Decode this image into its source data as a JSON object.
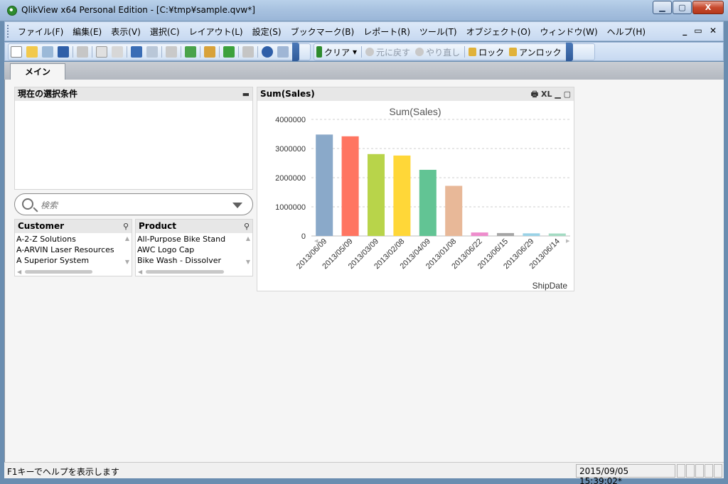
{
  "window": {
    "title": "QlikView x64 Personal Edition - [C:¥tmp¥sample.qvw*]",
    "minimize": "▁",
    "maximize": "▢",
    "close": "X"
  },
  "menu": {
    "items": [
      "ファイル(F)",
      "編集(E)",
      "表示(V)",
      "選択(C)",
      "レイアウト(L)",
      "設定(S)",
      "ブックマーク(B)",
      "レポート(R)",
      "ツール(T)",
      "オブジェクト(O)",
      "ウィンドウ(W)",
      "ヘルプ(H)"
    ],
    "right_controls": "_ ▭ ✕"
  },
  "toolbar": {
    "clear": "クリア",
    "undo": "元に戻す",
    "redo": "やり直し",
    "lock": "ロック",
    "unlock": "アンロック"
  },
  "tabs": [
    {
      "label": "メイン"
    }
  ],
  "current_selections": {
    "title": "現在の選択条件",
    "minimize": "▬"
  },
  "search": {
    "placeholder": "検索"
  },
  "customer_list": {
    "title": "Customer",
    "items": [
      "A-2-Z Solutions",
      "A-ARVIN Laser Resources",
      "A Superior System"
    ]
  },
  "product_list": {
    "title": "Product",
    "items": [
      "All-Purpose Bike Stand",
      "AWC Logo Cap",
      "Bike Wash - Dissolver"
    ]
  },
  "chart_object": {
    "caption": "Sum(Sales)",
    "icons": "🖶 XL ▁ ▢"
  },
  "chart_data": {
    "type": "bar",
    "title": "Sum(Sales)",
    "xlabel": "ShipDate",
    "ylabel": "",
    "categories": [
      "2013/06/09",
      "2013/05/09",
      "2013/03/09",
      "2013/02/08",
      "2013/04/09",
      "2013/01/08",
      "2013/06/22",
      "2013/06/15",
      "2013/06/29",
      "2013/06/14"
    ],
    "values": [
      3480000,
      3420000,
      2810000,
      2760000,
      2270000,
      1720000,
      120000,
      100000,
      90000,
      85000
    ],
    "colors": [
      "#8aa9c9",
      "#ff7561",
      "#b8d44a",
      "#ffd738",
      "#62c494",
      "#e8b898",
      "#ee8ccc",
      "#a5a5a5",
      "#9ad2e6",
      "#a4dbc3"
    ],
    "ylim": [
      0,
      4000000
    ],
    "yticks": [
      "0",
      "1000000",
      "2000000",
      "3000000",
      "4000000"
    ],
    "grid": true
  },
  "status": {
    "message": "F1キーでヘルプを表示します",
    "timestamp": "2015/09/05 15:39:02*"
  }
}
